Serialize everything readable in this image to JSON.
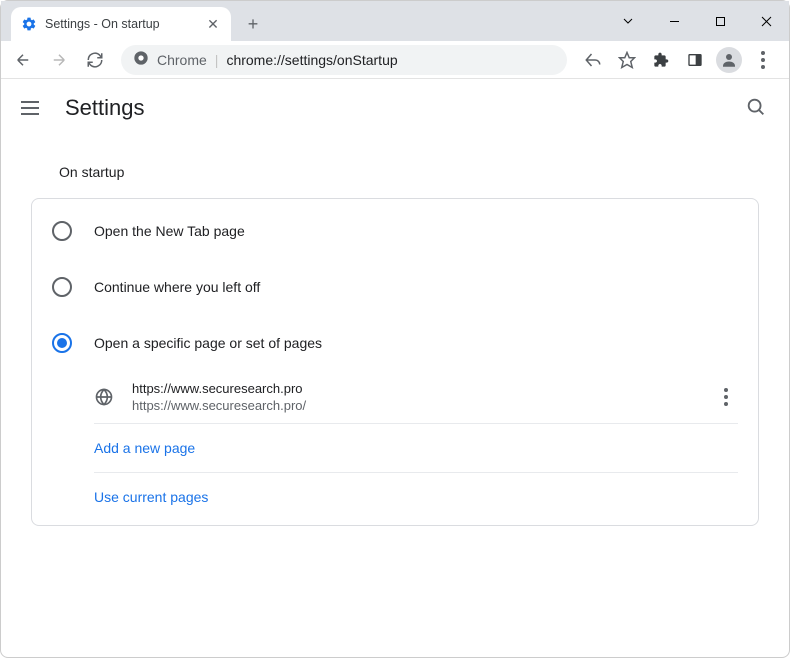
{
  "tab": {
    "title": "Settings - On startup"
  },
  "omnibox": {
    "prefix": "Chrome",
    "url": "chrome://settings/onStartup"
  },
  "header": {
    "title": "Settings"
  },
  "section": {
    "title": "On startup"
  },
  "options": {
    "opt1": "Open the New Tab page",
    "opt2": "Continue where you left off",
    "opt3": "Open a specific page or set of pages"
  },
  "pages": [
    {
      "name": "https://www.securesearch.pro",
      "url": "https://www.securesearch.pro/"
    }
  ],
  "actions": {
    "add": "Add a new page",
    "use_current": "Use current pages"
  }
}
